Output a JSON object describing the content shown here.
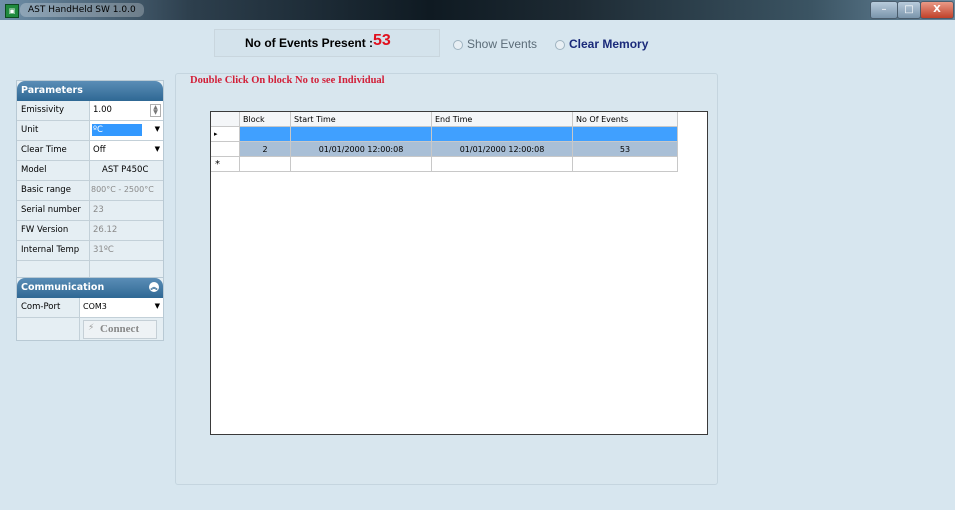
{
  "window": {
    "title": "AST HandHeld SW 1.0.0",
    "icon": "app-icon",
    "min": "–",
    "max": "□",
    "close": "X"
  },
  "events": {
    "label": "No of Events  Present :",
    "count": "53"
  },
  "options": {
    "show_events": "Show Events",
    "clear_memory": "Clear Memory"
  },
  "hint": "Double Click On block No to see Individual",
  "parameters": {
    "title": "Parameters",
    "rows": [
      {
        "label": "Emissivity",
        "value": "1.00",
        "control": "spinner"
      },
      {
        "label": "Unit",
        "value": "ºC",
        "control": "dropdown-selected"
      },
      {
        "label": "Clear Time",
        "value": "Off",
        "control": "dropdown"
      },
      {
        "label": "Model",
        "value": "AST P450C",
        "control": "text"
      },
      {
        "label": "Basic range",
        "value": "800°C - 2500°C",
        "control": "grey"
      },
      {
        "label": "Serial number",
        "value": "23",
        "control": "grey"
      },
      {
        "label": "FW Version",
        "value": "26.12",
        "control": "grey"
      },
      {
        "label": "Internal Temp",
        "value": "31ºC",
        "control": "grey"
      }
    ]
  },
  "communication": {
    "title": "Communication",
    "port_label": "Com-Port",
    "port_value": "COM3",
    "connect": "Connect"
  },
  "grid": {
    "columns": [
      "Block",
      "Start Time",
      "End Time",
      "No Of Events"
    ],
    "rows": [
      {
        "indicator": "▸",
        "cells": [
          "",
          "",
          "",
          ""
        ]
      },
      {
        "indicator": "",
        "cells": [
          "2",
          "01/01/2000 12:00:08",
          "01/01/2000 12:00:08",
          "53"
        ]
      },
      {
        "indicator": "*",
        "cells": [
          "",
          "",
          "",
          ""
        ]
      }
    ]
  }
}
